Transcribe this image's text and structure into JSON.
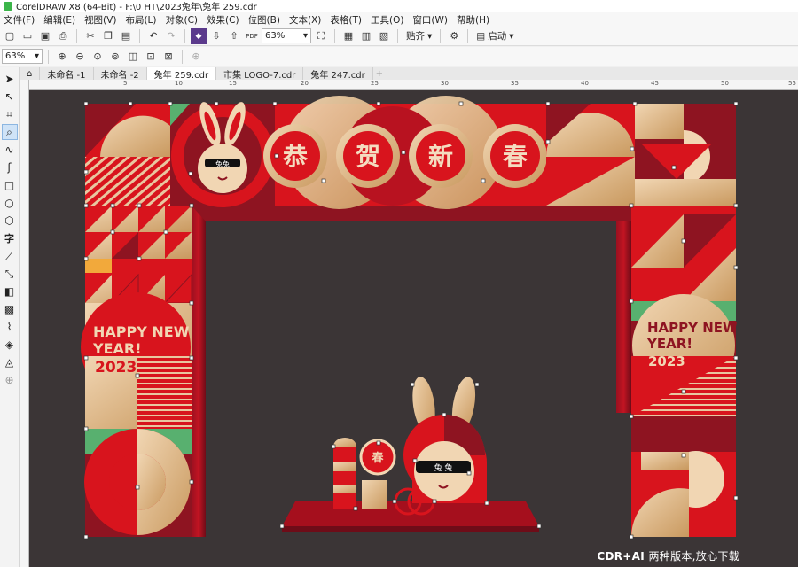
{
  "title": "CorelDRAW X8 (64-Bit) - F:\\0 HT\\2023兔年\\兔年 259.cdr",
  "menu": [
    "文件(F)",
    "编辑(E)",
    "视图(V)",
    "布局(L)",
    "对象(C)",
    "效果(C)",
    "位图(B)",
    "文本(X)",
    "表格(T)",
    "工具(O)",
    "窗口(W)",
    "帮助(H)"
  ],
  "toolbar": {
    "zoom_value": "63%",
    "pdf_label": "PDF",
    "snap_label": "贴齐",
    "launch_label": "启动"
  },
  "propbar": {
    "zoom_value": "63%"
  },
  "tabs": [
    "未命名 -1",
    "未命名 -2",
    "兔年 259.cdr",
    "市集 LOGO-7.cdr",
    "兔年 247.cdr"
  ],
  "active_tab": 2,
  "ruler_numbers": [
    "5",
    "10",
    "15",
    "20",
    "25",
    "30",
    "35",
    "40",
    "45",
    "50",
    "55"
  ],
  "artwork": {
    "greeting_chars": [
      "恭",
      "贺",
      "新",
      "春"
    ],
    "happy_new_year_left": [
      "HAPPY NEW",
      "YEAR!"
    ],
    "year_left": "2023",
    "happy_new_year_right": [
      "HAPPY NEW",
      "YEAR!"
    ],
    "year_right": "2023",
    "lantern_char": "春",
    "rabbit_glasses_small": "兔兔",
    "rabbit_glasses_big": "兔 兔"
  },
  "watermark": {
    "brand": "CDR+AI",
    "text": "两种版本,放心下载"
  },
  "colors": {
    "red": "#d8141d",
    "dark_red": "#8e1421",
    "gold": "#e8c7a0",
    "green": "#58b06f",
    "canvas": "#3b3536",
    "orange": "#f2a93b"
  }
}
